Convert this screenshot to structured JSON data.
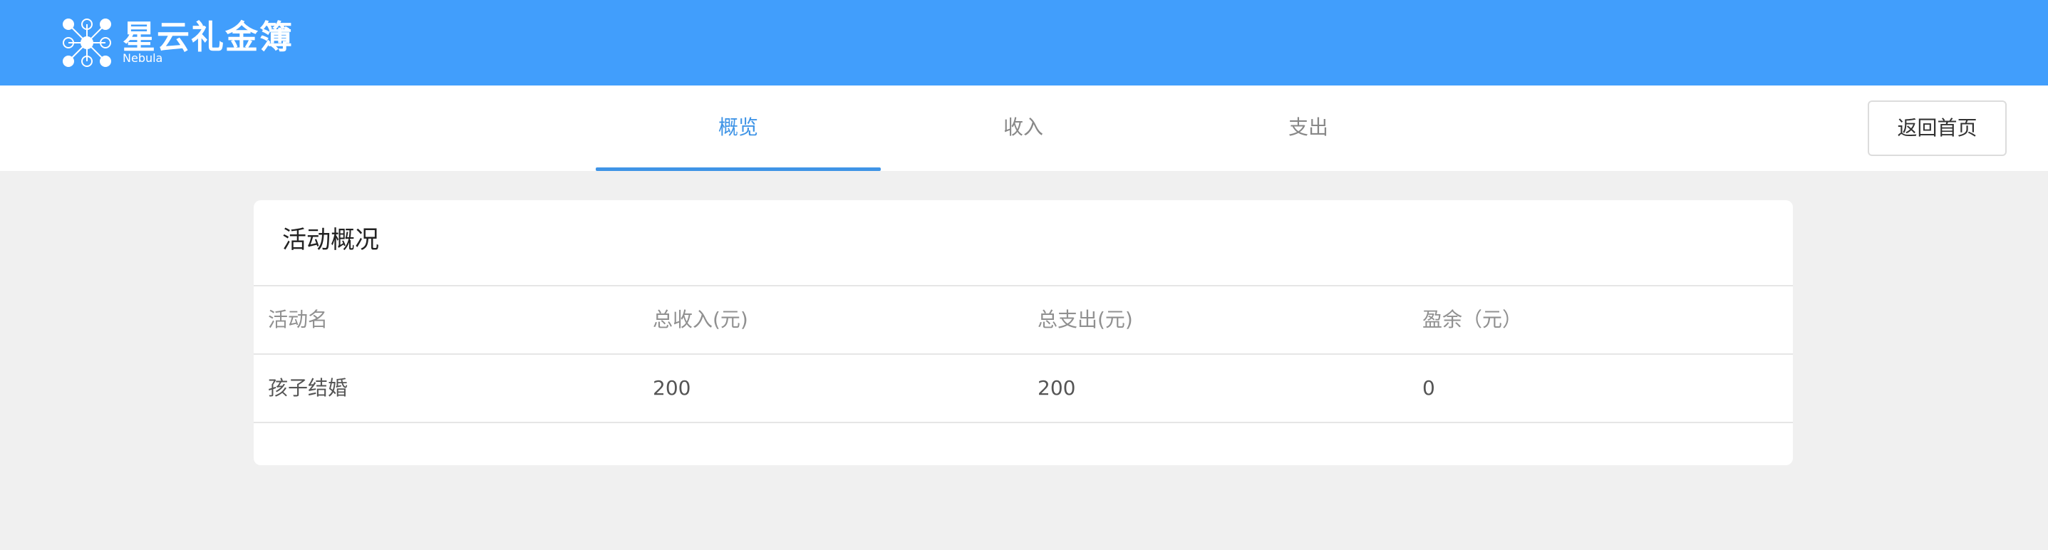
{
  "app": {
    "brand_name": "星云礼金簿",
    "brand_sub": "Nebula",
    "accent_color": "#419efc"
  },
  "nav": {
    "tabs": [
      {
        "label": "概览",
        "active": true
      },
      {
        "label": "收入",
        "active": false
      },
      {
        "label": "支出",
        "active": false
      }
    ],
    "home_button": "返回首页"
  },
  "overview": {
    "title": "活动概况",
    "columns": [
      "活动名",
      "总收入(元)",
      "总支出(元)",
      "盈余（元）"
    ],
    "rows": [
      [
        "孩子结婚",
        "200",
        "200",
        "0"
      ]
    ]
  }
}
